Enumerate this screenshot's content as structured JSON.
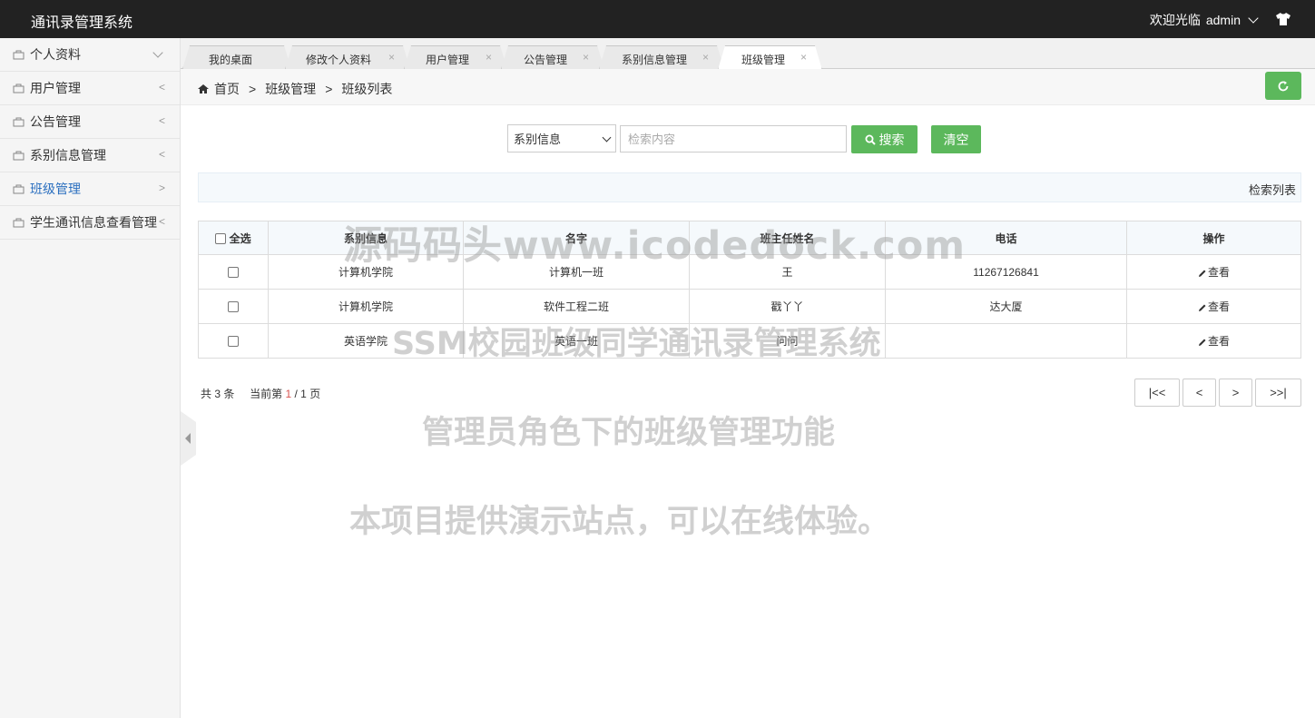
{
  "topbar": {
    "title": "通讯录管理系统",
    "welcome": "欢迎光临",
    "username": "admin"
  },
  "sidebar": {
    "items": [
      {
        "label": "个人资料",
        "arrow": "down"
      },
      {
        "label": "用户管理",
        "arrow": "<"
      },
      {
        "label": "公告管理",
        "arrow": "<"
      },
      {
        "label": "系别信息管理",
        "arrow": "<"
      },
      {
        "label": "班级管理",
        "arrow": ">",
        "active": true
      },
      {
        "label": "学生通讯信息查看管理",
        "arrow": "<"
      }
    ]
  },
  "tabs": [
    {
      "label": "我的桌面",
      "closable": false
    },
    {
      "label": "修改个人资料",
      "closable": true
    },
    {
      "label": "用户管理",
      "closable": true
    },
    {
      "label": "公告管理",
      "closable": true
    },
    {
      "label": "系别信息管理",
      "closable": true
    },
    {
      "label": "班级管理",
      "closable": true,
      "active": true
    }
  ],
  "tab_close_glyph": "×",
  "breadcrumb": {
    "home": "首页",
    "sep": ">",
    "level1": "班级管理",
    "level2": "班级列表"
  },
  "search": {
    "field_selected": "系别信息",
    "placeholder": "检索内容",
    "search_label": "搜索",
    "clear_label": "清空"
  },
  "list_header": "检索列表",
  "table": {
    "headers": [
      "全选",
      "系别信息",
      "名字",
      "班主任姓名",
      "电话",
      "操作"
    ],
    "rows": [
      {
        "dept": "计算机学院",
        "name": "计算机一班",
        "teacher": "王",
        "phone": "11267126841",
        "action": "查看"
      },
      {
        "dept": "计算机学院",
        "name": "软件工程二班",
        "teacher": "戳丫丫",
        "phone": "达大厦",
        "action": "查看"
      },
      {
        "dept": "英语学院",
        "name": "英语一班",
        "teacher": "问问",
        "phone": "",
        "action": "查看"
      }
    ]
  },
  "pager": {
    "total_prefix": "共",
    "total": "3",
    "total_suffix": "条",
    "current_prefix": "当前第",
    "current": "1",
    "slash": "/",
    "pages": "1",
    "pages_suffix": "页",
    "first": "|<<",
    "prev": "<",
    "next": ">",
    "last": ">>|"
  },
  "watermarks": {
    "line1": "源码码头www.icodedock.com",
    "line2": "SSM校园班级同学通讯录管理系统",
    "line3": "管理员角色下的班级管理功能",
    "line4": "本项目提供演示站点，可以在线体验。"
  },
  "colors": {
    "topbar": "#222222",
    "accent_green": "#5cb85c",
    "active_link": "#2a6fbf",
    "page_current": "#d9534f"
  }
}
